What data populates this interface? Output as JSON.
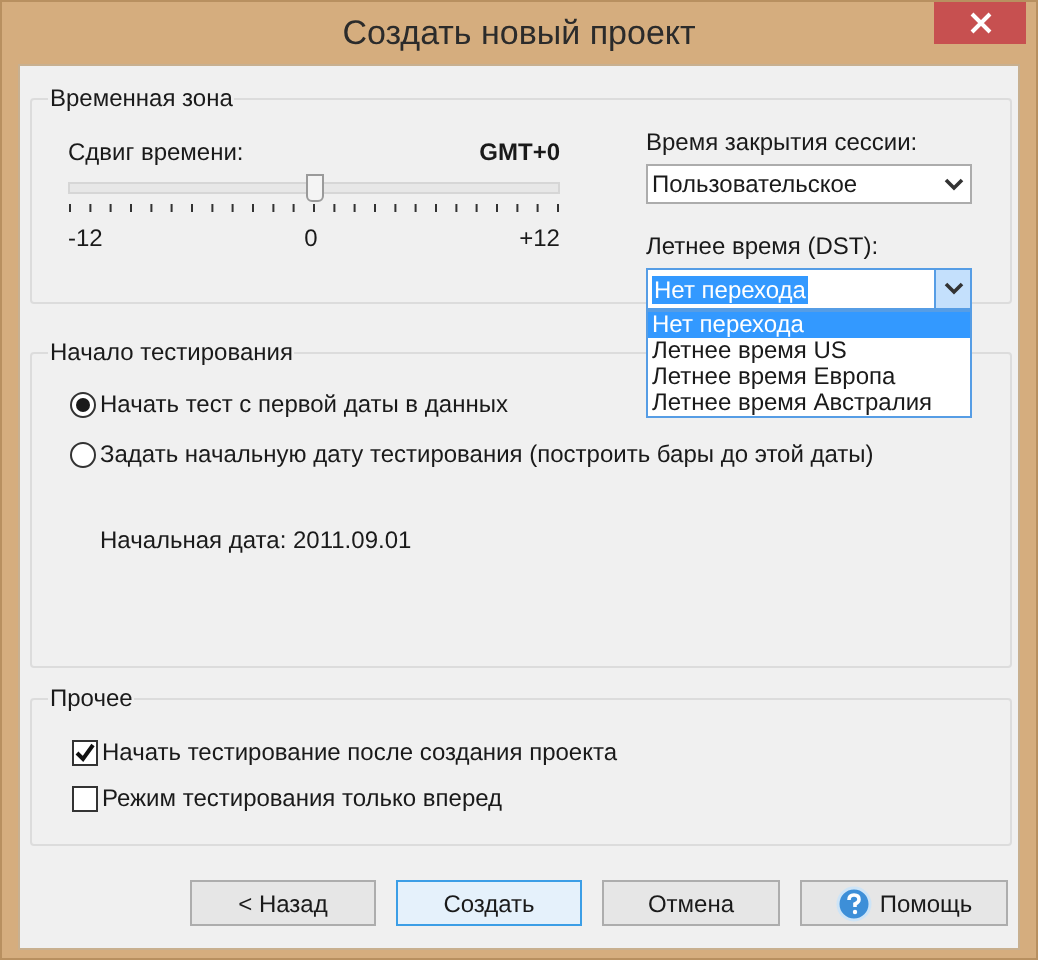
{
  "window": {
    "title": "Создать новый проект"
  },
  "time_zone": {
    "title": "Временная зона",
    "shift_label": "Сдвиг времени:",
    "shift_value": "GMT+0",
    "slider": {
      "level": 0.5
    },
    "scale": [
      "-12",
      "0",
      "+12"
    ],
    "session_close": {
      "label": "Время закрытия сессии:",
      "value": "Пользовательское"
    },
    "dst": {
      "label": "Летнее время (DST):",
      "value": "Нет перехода",
      "expanded": true,
      "options": [
        {
          "label": "Нет перехода",
          "selected": true
        },
        {
          "label": "Летнее время US",
          "selected": false
        },
        {
          "label": "Летнее время Европа",
          "selected": false
        },
        {
          "label": "Летнее время Австралия",
          "selected": false
        }
      ]
    }
  },
  "test_start": {
    "title": "Начало тестирования",
    "options": [
      {
        "label": "Начать тест с первой даты в данных",
        "selected": true
      },
      {
        "label": "Задать начальную дату тестирования (построить бары до этой даты)",
        "selected": false
      }
    ],
    "start_date": "Начальная дата: 2011.09.01"
  },
  "other": {
    "title": "Прочее",
    "options": [
      {
        "label": "Начать тестирование после создания проекта",
        "checked": true
      },
      {
        "label": "Режим тестирования только вперед",
        "checked": false
      }
    ]
  },
  "buttons": [
    {
      "label": "< Назад",
      "kind": "plain"
    },
    {
      "label": "Создать",
      "kind": "default"
    },
    {
      "label": "Отмена",
      "kind": "plain"
    },
    {
      "label": "Помощь",
      "kind": "help"
    }
  ]
}
